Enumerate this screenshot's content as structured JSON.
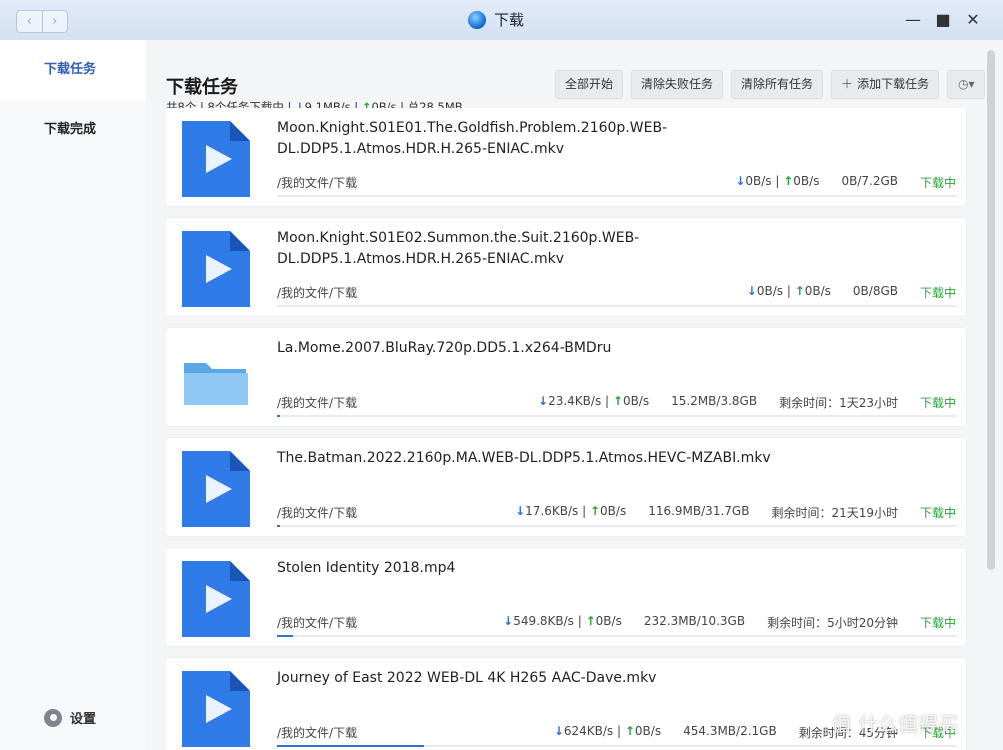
{
  "window": {
    "title": "下载",
    "nav_back": "‹",
    "nav_forward": "›",
    "minimize": "—",
    "maximize": "■",
    "close": "✕"
  },
  "sidebar": {
    "items": [
      {
        "label": "下载任务"
      },
      {
        "label": "下载完成"
      }
    ],
    "settings_label": "设置"
  },
  "main": {
    "title": "下载任务",
    "summary": {
      "counts": "共8个 | 8个任务下载中 | ",
      "down_arrow": "↓",
      "down": "9.1MB/s",
      "sep": " | ",
      "up_arrow": "↑",
      "up": "0B/s",
      "total": " | 总28.5MB"
    },
    "toolbar": {
      "start_all": "全部开始",
      "clear_failed": "清除失败任务",
      "clear_all": "清除所有任务",
      "add_plus": "＋",
      "add_task": "添加下载任务",
      "clock_icon": "◷▾"
    }
  },
  "tasks": [
    {
      "icon": "video-file-icon",
      "name": "Moon.Knight.S01E01.The.Goldfish.Problem.2160p.WEB-DL.DDP5.1.Atmos.HDR.H.265-ENIAC.mkv",
      "path": "/我的文件/下载",
      "down": "0B/s",
      "up": "0B/s",
      "size": "0B/7.2GB",
      "remaining": "",
      "status": "下载中",
      "progress": 0
    },
    {
      "icon": "video-file-icon",
      "name": "Moon.Knight.S01E02.Summon.the.Suit.2160p.WEB-DL.DDP5.1.Atmos.HDR.H.265-ENIAC.mkv",
      "path": "/我的文件/下载",
      "down": "0B/s",
      "up": "0B/s",
      "size": "0B/8GB",
      "remaining": "",
      "status": "下载中",
      "progress": 0
    },
    {
      "icon": "folder-icon",
      "name": "La.Mome.2007.BluRay.720p.DD5.1.x264-BMDru",
      "path": "/我的文件/下载",
      "down": "23.4KB/s",
      "up": "0B/s",
      "size": "15.2MB/3.8GB",
      "remaining": "剩余时间：1天23小时",
      "status": "下载中",
      "progress": 0.004
    },
    {
      "icon": "video-file-icon",
      "name": "The.Batman.2022.2160p.MA.WEB-DL.DDP5.1.Atmos.HEVC-MZABI.mkv",
      "path": "/我的文件/下载",
      "down": "17.6KB/s",
      "up": "0B/s",
      "size": "116.9MB/31.7GB",
      "remaining": "剩余时间：21天19小时",
      "status": "下载中",
      "progress": 0.004
    },
    {
      "icon": "video-file-icon",
      "name": "Stolen Identity 2018.mp4",
      "path": "/我的文件/下载",
      "down": "549.8KB/s",
      "up": "0B/s",
      "size": "232.3MB/10.3GB",
      "remaining": "剩余时间：5小时20分钟",
      "status": "下载中",
      "progress": 0.023
    },
    {
      "icon": "video-file-icon",
      "name": "Journey of East 2022 WEB-DL 4K H265 AAC-Dave.mkv",
      "path": "/我的文件/下载",
      "down": "624KB/s",
      "up": "0B/s",
      "size": "454.3MB/2.1GB",
      "remaining": "剩余时间：45分钟",
      "status": "下载中",
      "progress": 0.216
    }
  ],
  "watermark": "值 什么值得买"
}
